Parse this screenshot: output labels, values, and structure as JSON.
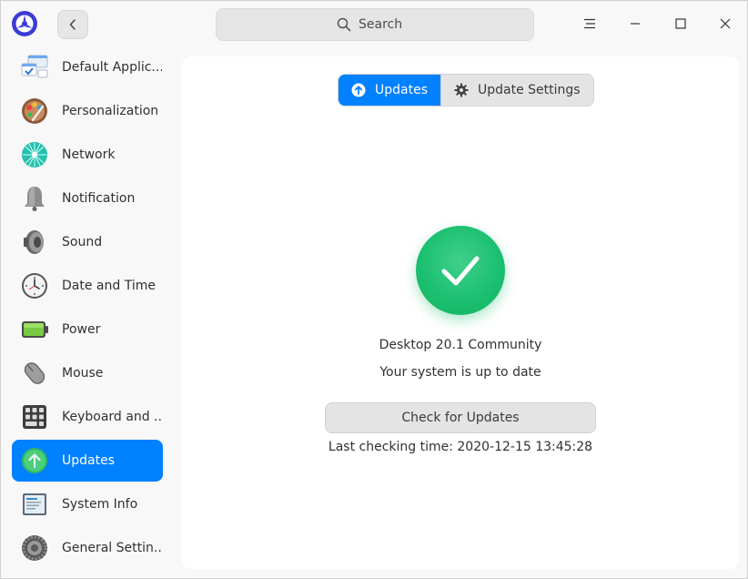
{
  "titlebar": {
    "search_placeholder": "Search"
  },
  "sidebar": {
    "items": [
      {
        "label": "Default Applic...",
        "icon": "default-apps-icon"
      },
      {
        "label": "Personalization",
        "icon": "personalization-icon"
      },
      {
        "label": "Network",
        "icon": "network-icon"
      },
      {
        "label": "Notification",
        "icon": "bell-icon"
      },
      {
        "label": "Sound",
        "icon": "speaker-icon"
      },
      {
        "label": "Date and Time",
        "icon": "clock-icon"
      },
      {
        "label": "Power",
        "icon": "battery-icon"
      },
      {
        "label": "Mouse",
        "icon": "mouse-icon"
      },
      {
        "label": "Keyboard and ...",
        "icon": "keyboard-icon"
      },
      {
        "label": "Updates",
        "icon": "updates-icon",
        "active": true
      },
      {
        "label": "System Info",
        "icon": "system-info-icon"
      },
      {
        "label": "General Settin...",
        "icon": "general-settings-icon"
      }
    ]
  },
  "main": {
    "tabs": [
      {
        "label": "Updates",
        "active": true
      },
      {
        "label": "Update Settings",
        "active": false
      }
    ],
    "version": "Desktop 20.1 Community",
    "status": "Your system is up to date",
    "check_button": "Check for Updates",
    "last_checking": "Last checking time: 2020-12-15 13:45:28"
  },
  "colors": {
    "accent": "#0081ff",
    "success": "#1cc071"
  }
}
